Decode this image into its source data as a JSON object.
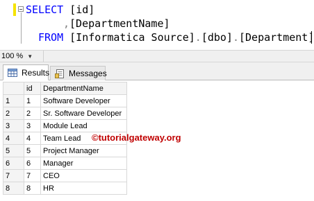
{
  "query": {
    "line1": {
      "keyword": "SELECT",
      "text": " [id]"
    },
    "line2": {
      "comma": ",",
      "text": "[DepartmentName]"
    },
    "line3": {
      "keyword": "FROM",
      "db": "[Informatica Source]",
      "schema": "[dbo]",
      "table": "[Department]",
      "dot": "."
    }
  },
  "zoom": {
    "value": "100 %"
  },
  "tabs": [
    {
      "label": "Results",
      "icon": "grid-icon",
      "active": true
    },
    {
      "label": "Messages",
      "icon": "messages-icon",
      "active": false
    }
  ],
  "results": {
    "columns": [
      "id",
      "DepartmentName"
    ],
    "rows": [
      {
        "num": "1",
        "id": "1",
        "name": "Software Developer"
      },
      {
        "num": "2",
        "id": "2",
        "name": "Sr. Software Developer"
      },
      {
        "num": "3",
        "id": "3",
        "name": "Module Lead"
      },
      {
        "num": "4",
        "id": "4",
        "name": "Team Lead"
      },
      {
        "num": "5",
        "id": "5",
        "name": "Project Manager"
      },
      {
        "num": "6",
        "id": "6",
        "name": "Manager"
      },
      {
        "num": "7",
        "id": "7",
        "name": "CEO"
      },
      {
        "num": "8",
        "id": "8",
        "name": "HR"
      }
    ]
  },
  "watermark": "©tutorialgateway.org",
  "colors": {
    "keyword": "#0000ff",
    "watermark": "#c00000",
    "operator": "#808080"
  }
}
